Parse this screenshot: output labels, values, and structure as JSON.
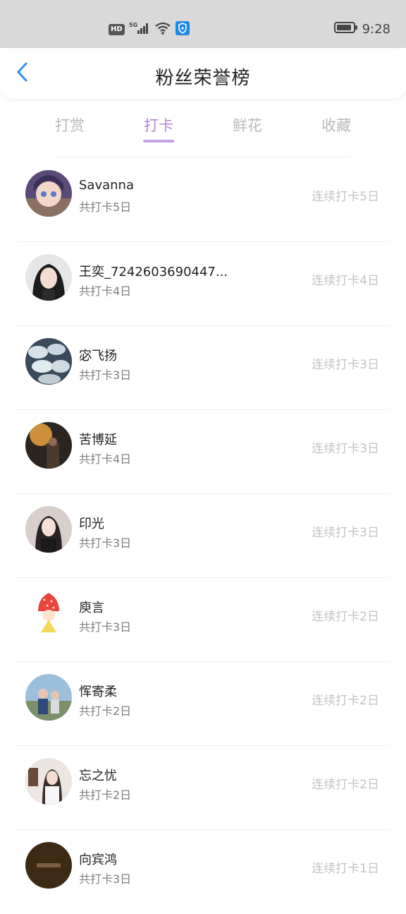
{
  "status_bar": {
    "hd_label": "HD",
    "network_label": "5G",
    "time": "9:28"
  },
  "header": {
    "title": "粉丝荣誉榜",
    "back_icon": "chevron-left-icon"
  },
  "tabs": [
    {
      "label": "打赏",
      "active": false
    },
    {
      "label": "打卡",
      "active": true
    },
    {
      "label": "鲜花",
      "active": false
    },
    {
      "label": "收藏",
      "active": false
    }
  ],
  "colors": {
    "accent": "#b087d9",
    "indicator": "#c6a4e8",
    "muted": "#c4c4c4",
    "status_bar_bg": "#d9d9d9"
  },
  "fans": [
    {
      "name": "Savanna",
      "total": "共打卡5日",
      "streak": "连续打卡5日"
    },
    {
      "name": "王奕_7242603690447...",
      "total": "共打卡4日",
      "streak": "连续打卡4日"
    },
    {
      "name": "宓飞扬",
      "total": "共打卡3日",
      "streak": "连续打卡3日"
    },
    {
      "name": "苦博延",
      "total": "共打卡4日",
      "streak": "连续打卡3日"
    },
    {
      "name": "印光",
      "total": "共打卡3日",
      "streak": "连续打卡3日"
    },
    {
      "name": "庾言",
      "total": "共打卡3日",
      "streak": "连续打卡2日"
    },
    {
      "name": "恽寄柔",
      "total": "共打卡2日",
      "streak": "连续打卡2日"
    },
    {
      "name": "忘之忧",
      "total": "共打卡2日",
      "streak": "连续打卡2日"
    },
    {
      "name": "向宾鸿",
      "total": "共打卡3日",
      "streak": "连续打卡1日"
    }
  ]
}
